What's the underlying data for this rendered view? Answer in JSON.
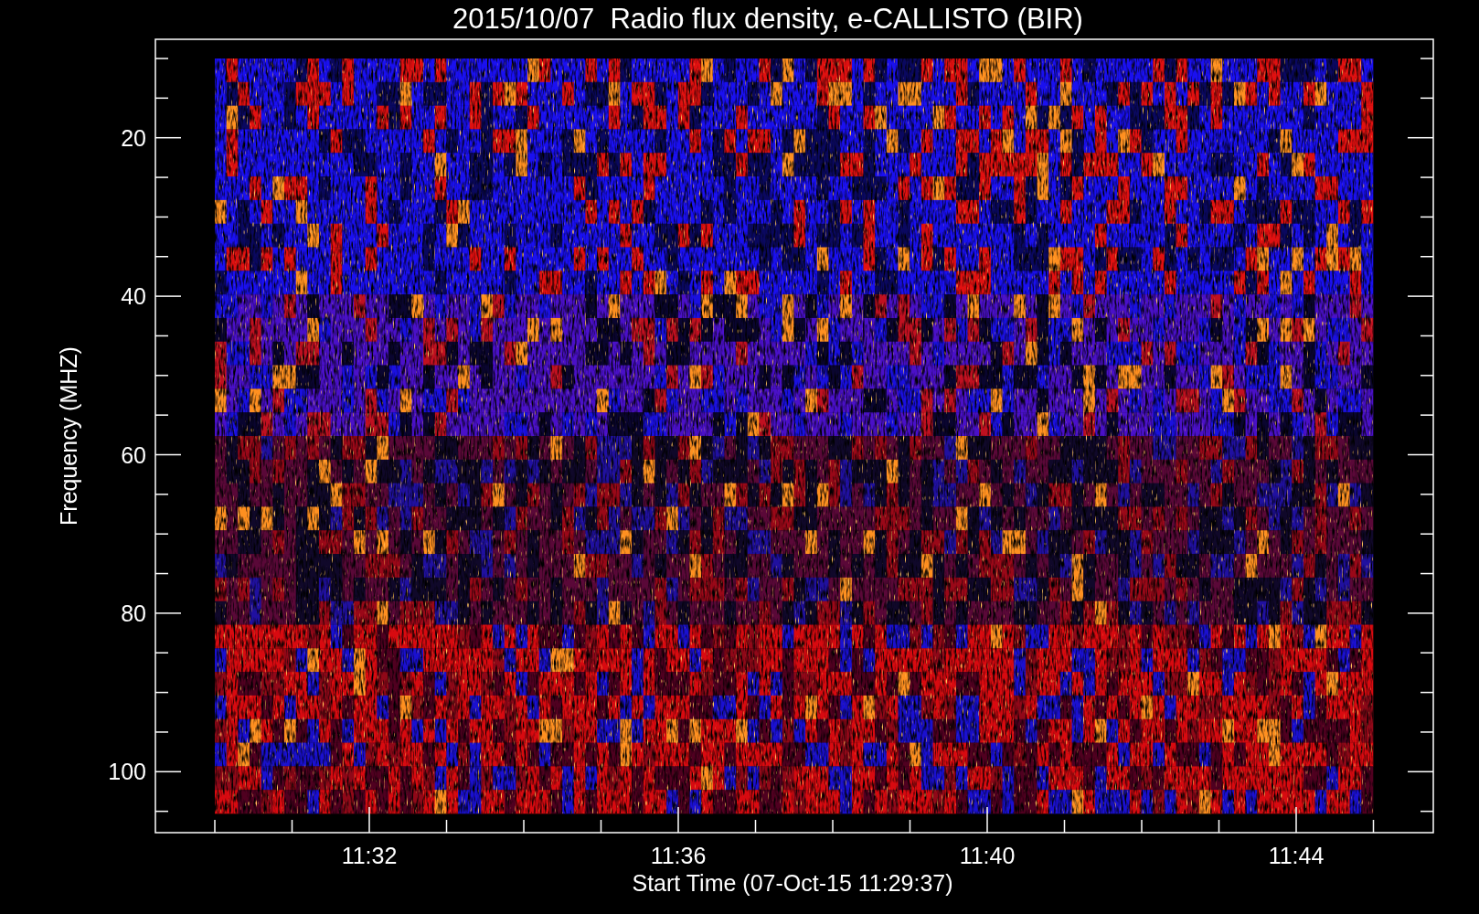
{
  "title": "2015/10/07  Radio flux density, e-CALLISTO (BIR)",
  "y_axis": {
    "label": "Frequency (MHZ)",
    "ticks": [
      "20",
      "40",
      "60",
      "80",
      "100"
    ]
  },
  "x_axis": {
    "label": "Start Time (07-Oct-15 11:29:37)",
    "ticks": [
      "11:32",
      "11:36",
      "11:40",
      "11:44"
    ]
  }
}
